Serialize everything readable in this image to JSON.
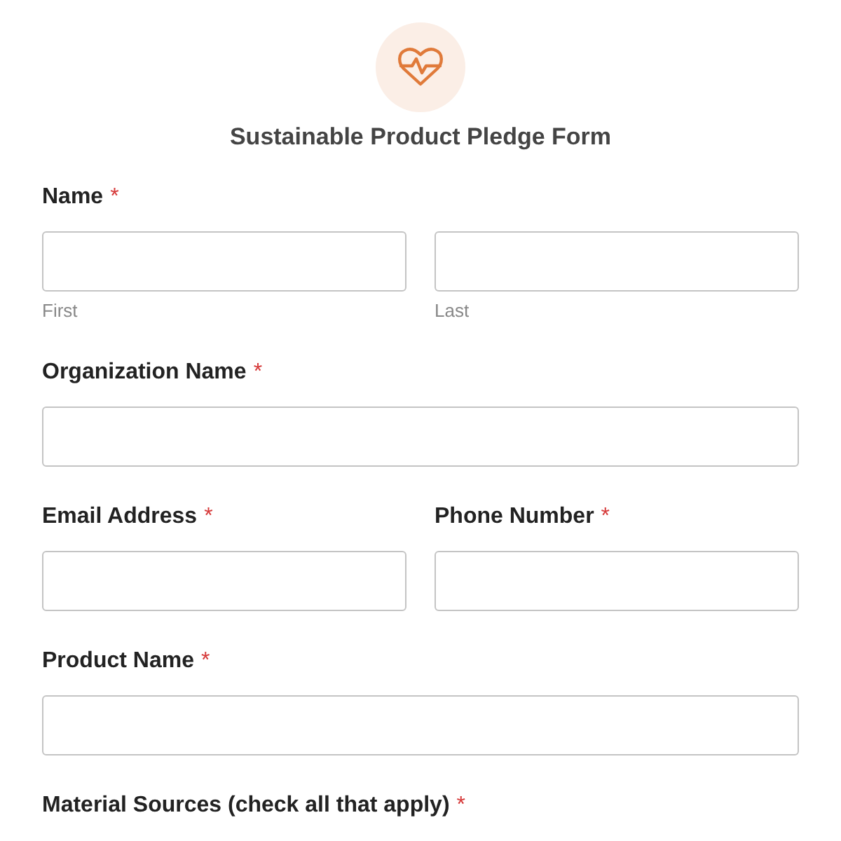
{
  "title": "Sustainable Product Pledge Form",
  "rows": [
    {
      "fields": [
        {
          "kind": "name",
          "label": "Name",
          "required_mark": "*",
          "sublabels": [
            "First",
            "Last"
          ]
        }
      ]
    },
    {
      "fields": [
        {
          "kind": "text",
          "label": "Organization Name",
          "required_mark": "*"
        }
      ]
    },
    {
      "fields": [
        {
          "kind": "text",
          "label": "Email Address",
          "required_mark": "*"
        },
        {
          "kind": "text",
          "label": "Phone Number",
          "required_mark": "*"
        }
      ]
    },
    {
      "fields": [
        {
          "kind": "text",
          "label": "Product Name",
          "required_mark": "*"
        }
      ]
    },
    {
      "fields": [
        {
          "kind": "heading",
          "label": "Material Sources (check all that apply)",
          "required_mark": "*"
        }
      ]
    }
  ]
}
